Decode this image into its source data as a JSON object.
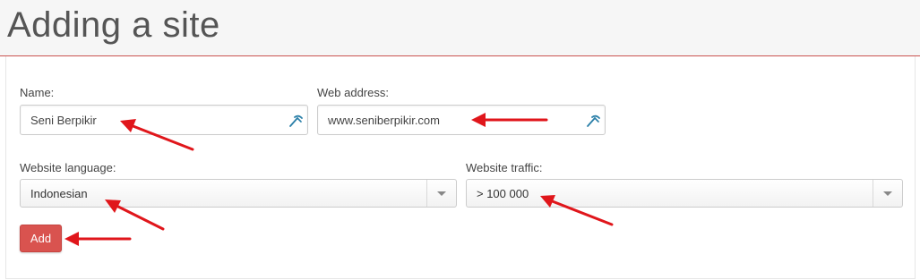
{
  "page": {
    "title": "Adding a site"
  },
  "form": {
    "name": {
      "label": "Name:",
      "value": "Seni Berpikir",
      "icon": "edit-icon"
    },
    "web_address": {
      "label": "Web address:",
      "value": "www.seniberpikir.com",
      "icon": "edit-icon"
    },
    "language": {
      "label": "Website language:",
      "selected": "Indonesian"
    },
    "traffic": {
      "label": "Website traffic:",
      "selected": "> 100 000"
    },
    "add_label": "Add"
  },
  "colors": {
    "accent": "#d9534f",
    "header_border": "#c9534f",
    "annotation_arrow": "#e0161b",
    "edit_icon": "#2a7fa8"
  }
}
